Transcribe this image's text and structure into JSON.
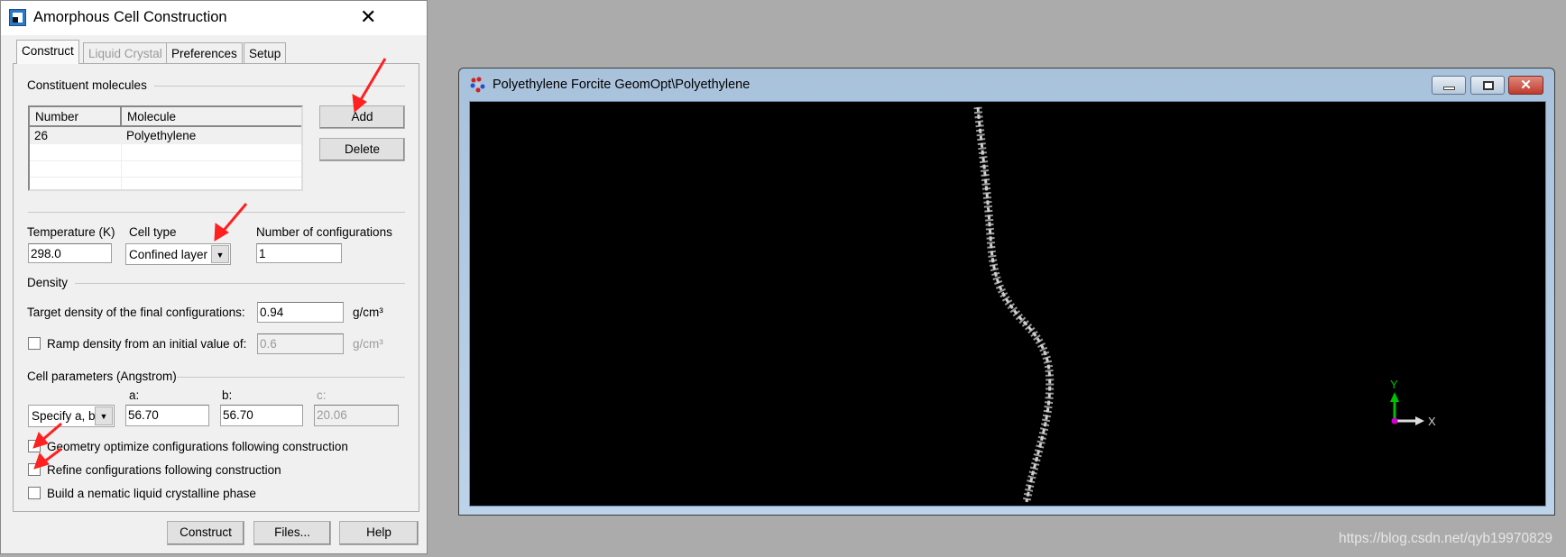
{
  "dialog": {
    "title": "Amorphous Cell Construction",
    "tabs": [
      {
        "label": "Construct",
        "state": "active"
      },
      {
        "label": "Liquid Crystal",
        "state": "disabled"
      },
      {
        "label": "Preferences",
        "state": "normal"
      },
      {
        "label": "Setup",
        "state": "normal"
      }
    ],
    "constituent": {
      "heading": "Constituent molecules",
      "columns": [
        "Number",
        "Molecule"
      ],
      "rows": [
        [
          "26",
          "Polyethylene"
        ]
      ],
      "add_label": "Add",
      "delete_label": "Delete"
    },
    "temperature": {
      "label": "Temperature (K)",
      "value": "298.0"
    },
    "cell_type": {
      "label": "Cell type",
      "value": "Confined layer"
    },
    "configurations": {
      "label": "Number of configurations",
      "value": "1"
    },
    "density": {
      "heading": "Density",
      "target_label": "Target density of the final configurations:",
      "target_value": "0.94",
      "unit": "g/cm³",
      "ramp_label": "Ramp density from an initial value of:",
      "ramp_value": "0.6",
      "ramp_unit": "g/cm³",
      "ramp_checked": false
    },
    "cell_params": {
      "heading": "Cell parameters (Angstrom)",
      "mode": "Specify a, b",
      "a_label": "a:",
      "a": "56.70",
      "b_label": "b:",
      "b": "56.70",
      "c_label": "c:",
      "c": "20.06"
    },
    "options": [
      {
        "label": "Geometry optimize configurations following construction",
        "checked": false
      },
      {
        "label": "Refine configurations following construction",
        "checked": false
      },
      {
        "label": "Build a nematic liquid crystalline phase",
        "checked": false
      }
    ],
    "buttons": {
      "construct": "Construct",
      "files": "Files...",
      "help": "Help"
    }
  },
  "viewer": {
    "title": "Polyethylene Forcite GeomOpt\\Polyethylene",
    "axes": {
      "y": "Y",
      "x": "X",
      "y_color": "#00c000",
      "z_color": "#d000d0"
    }
  },
  "watermark": "https://blog.csdn.net/qyb19970829",
  "colors": {
    "annotation_arrow": "#ff2020",
    "viewport": "#000000",
    "close_button": "#c9463d"
  }
}
